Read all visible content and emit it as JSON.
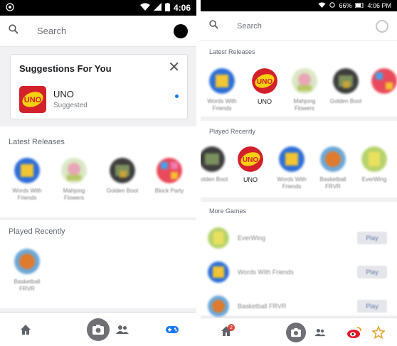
{
  "left": {
    "status": {
      "time": "4:06"
    },
    "search": {
      "placeholder": "Search"
    },
    "suggestions": {
      "title": "Suggestions For You",
      "game_name": "UNO",
      "game_sub": "Suggested"
    },
    "latest": {
      "title": "Latest Releases",
      "items": [
        {
          "label": "Words With\nFriends"
        },
        {
          "label": "Mahjong\nFlowers"
        },
        {
          "label": "Golden Boot"
        },
        {
          "label": "Block Party"
        }
      ]
    },
    "played": {
      "title": "Played Recently",
      "items": [
        {
          "label": "Basketball\nFRVR"
        }
      ]
    }
  },
  "right": {
    "status": {
      "battery": "66%",
      "time": "4:06 PM"
    },
    "search": {
      "placeholder": "Search"
    },
    "latest": {
      "title": "Latest Releases",
      "items": [
        {
          "label": "Words With\nFriends"
        },
        {
          "label": "UNO"
        },
        {
          "label": "Mahjong\nFlowers"
        },
        {
          "label": "Golden Boot"
        }
      ]
    },
    "played": {
      "title": "Played Recently",
      "items": [
        {
          "label": "Golden Boot"
        },
        {
          "label": "UNO"
        },
        {
          "label": "Words With\nFriends"
        },
        {
          "label": "Basketball\nFRVR"
        },
        {
          "label": "EverWing"
        }
      ]
    },
    "more": {
      "title": "More Games",
      "items": [
        {
          "label": "EverWing",
          "action": "Play"
        },
        {
          "label": "Words With Friends",
          "action": "Play"
        },
        {
          "label": "Basketball FRVR",
          "action": "Play"
        }
      ]
    },
    "nav": {
      "badge": "2"
    }
  }
}
